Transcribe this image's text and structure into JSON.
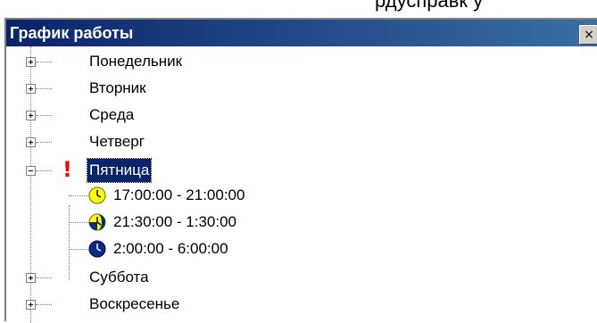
{
  "background_text": "рдусправк у",
  "window": {
    "title": "График работы",
    "close_label": "×",
    "colors": {
      "titlebar_start": "#0a246a",
      "titlebar_end": "#3a6ea5",
      "selection": "#0a246a",
      "alert": "#ff0000",
      "clock_day": "#ffff00",
      "clock_night": "#0a2a8a"
    }
  },
  "tree": {
    "days": [
      {
        "label": "Понедельник",
        "expanded": false
      },
      {
        "label": "Вторник",
        "expanded": false
      },
      {
        "label": "Среда",
        "expanded": false
      },
      {
        "label": "Четверг",
        "expanded": false
      },
      {
        "label": "Пятница",
        "expanded": true,
        "selected": true,
        "alert": "!"
      },
      {
        "label": "Суббота",
        "expanded": false
      },
      {
        "label": "Воскресенье",
        "expanded": false
      }
    ],
    "intervals": [
      {
        "label": "17:00:00 - 21:00:00",
        "icon": "clock-day-icon"
      },
      {
        "label": "21:30:00 - 1:30:00",
        "icon": "clock-evening-icon"
      },
      {
        "label": "2:00:00 - 6:00:00",
        "icon": "clock-night-icon"
      }
    ]
  }
}
